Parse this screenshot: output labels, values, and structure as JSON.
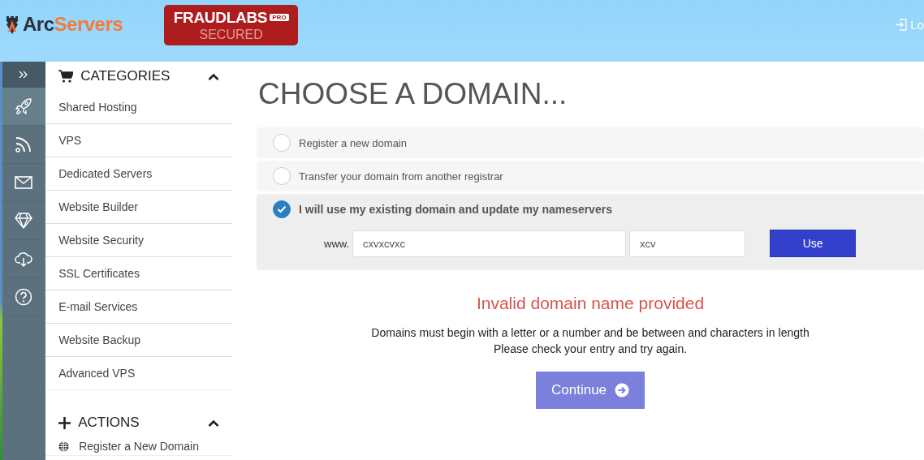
{
  "header": {
    "logo": {
      "first": "Arc",
      "second": "Servers"
    },
    "badge": {
      "title": "FRAUDLABS",
      "tag": "PRO",
      "subtitle": "SECURED"
    },
    "login": "Lo"
  },
  "rail": {
    "items": [
      {
        "kind": "rocket",
        "selected": true
      },
      {
        "kind": "rss",
        "selected": false
      },
      {
        "kind": "mail",
        "selected": false
      },
      {
        "kind": "diamond",
        "selected": false
      },
      {
        "kind": "cloud",
        "selected": false
      },
      {
        "kind": "help",
        "selected": false
      }
    ]
  },
  "sidebar": {
    "sections": [
      {
        "kind": "cart",
        "title": "CATEGORIES",
        "expanded": true,
        "items": [
          "Shared Hosting",
          "VPS",
          "Dedicated Servers",
          "Website Builder",
          "Website Security",
          "SSL Certificates",
          "E-mail Services",
          "Website Backup",
          "Advanced VPS"
        ]
      },
      {
        "kind": "plus",
        "title": "ACTIONS",
        "expanded": true,
        "items": [
          "Register a New Domain"
        ]
      }
    ]
  },
  "main": {
    "title": "CHOOSE A DOMAIN...",
    "options": [
      {
        "label": "Register a new domain",
        "selected": false
      },
      {
        "label": "Transfer your domain from another registrar",
        "selected": false
      },
      {
        "label": "I will use my existing domain and update my nameservers",
        "selected": true
      }
    ],
    "domain_form": {
      "prefix": "www.",
      "name": "cxvxcvxc",
      "tld": "xcv",
      "button": "Use"
    },
    "error": {
      "title": "Invalid domain name provided",
      "lines": [
        "Domains must begin with a letter or a number and be between and characters in length",
        "Please check your entry and try again."
      ]
    },
    "continue": "Continue"
  }
}
